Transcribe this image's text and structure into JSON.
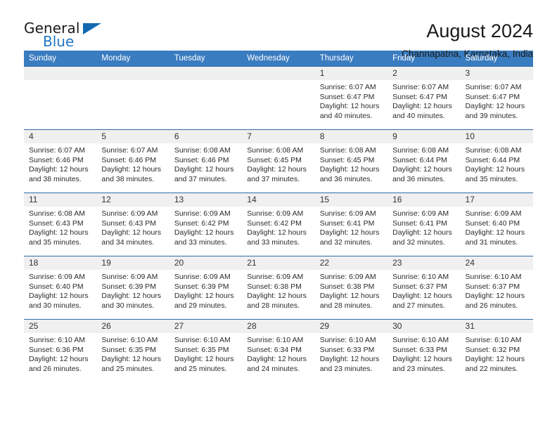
{
  "brand": {
    "name_top": "General",
    "name_bottom": "Blue",
    "triangle_color": "#1269b0",
    "blue_color": "#2176c7"
  },
  "header": {
    "title": "August 2024",
    "subtitle": "Channapatna, Karnataka, India"
  },
  "theme": {
    "header_row_bg": "#3a7cc0",
    "header_row_text": "#ffffff",
    "daynum_bg": "#f0f0f0",
    "grid_line": "#2f6ca8"
  },
  "calendar": {
    "weekday_headers": [
      "Sunday",
      "Monday",
      "Tuesday",
      "Wednesday",
      "Thursday",
      "Friday",
      "Saturday"
    ],
    "weeks": [
      [
        {
          "day": "",
          "sunrise": "",
          "sunset": "",
          "daylight": "",
          "blank": true
        },
        {
          "day": "",
          "sunrise": "",
          "sunset": "",
          "daylight": "",
          "blank": true
        },
        {
          "day": "",
          "sunrise": "",
          "sunset": "",
          "daylight": "",
          "blank": true
        },
        {
          "day": "",
          "sunrise": "",
          "sunset": "",
          "daylight": "",
          "blank": true
        },
        {
          "day": "1",
          "sunrise": "Sunrise: 6:07 AM",
          "sunset": "Sunset: 6:47 PM",
          "daylight": "Daylight: 12 hours and 40 minutes."
        },
        {
          "day": "2",
          "sunrise": "Sunrise: 6:07 AM",
          "sunset": "Sunset: 6:47 PM",
          "daylight": "Daylight: 12 hours and 40 minutes."
        },
        {
          "day": "3",
          "sunrise": "Sunrise: 6:07 AM",
          "sunset": "Sunset: 6:47 PM",
          "daylight": "Daylight: 12 hours and 39 minutes."
        }
      ],
      [
        {
          "day": "4",
          "sunrise": "Sunrise: 6:07 AM",
          "sunset": "Sunset: 6:46 PM",
          "daylight": "Daylight: 12 hours and 38 minutes."
        },
        {
          "day": "5",
          "sunrise": "Sunrise: 6:07 AM",
          "sunset": "Sunset: 6:46 PM",
          "daylight": "Daylight: 12 hours and 38 minutes."
        },
        {
          "day": "6",
          "sunrise": "Sunrise: 6:08 AM",
          "sunset": "Sunset: 6:46 PM",
          "daylight": "Daylight: 12 hours and 37 minutes."
        },
        {
          "day": "7",
          "sunrise": "Sunrise: 6:08 AM",
          "sunset": "Sunset: 6:45 PM",
          "daylight": "Daylight: 12 hours and 37 minutes."
        },
        {
          "day": "8",
          "sunrise": "Sunrise: 6:08 AM",
          "sunset": "Sunset: 6:45 PM",
          "daylight": "Daylight: 12 hours and 36 minutes."
        },
        {
          "day": "9",
          "sunrise": "Sunrise: 6:08 AM",
          "sunset": "Sunset: 6:44 PM",
          "daylight": "Daylight: 12 hours and 36 minutes."
        },
        {
          "day": "10",
          "sunrise": "Sunrise: 6:08 AM",
          "sunset": "Sunset: 6:44 PM",
          "daylight": "Daylight: 12 hours and 35 minutes."
        }
      ],
      [
        {
          "day": "11",
          "sunrise": "Sunrise: 6:08 AM",
          "sunset": "Sunset: 6:43 PM",
          "daylight": "Daylight: 12 hours and 35 minutes."
        },
        {
          "day": "12",
          "sunrise": "Sunrise: 6:09 AM",
          "sunset": "Sunset: 6:43 PM",
          "daylight": "Daylight: 12 hours and 34 minutes."
        },
        {
          "day": "13",
          "sunrise": "Sunrise: 6:09 AM",
          "sunset": "Sunset: 6:42 PM",
          "daylight": "Daylight: 12 hours and 33 minutes."
        },
        {
          "day": "14",
          "sunrise": "Sunrise: 6:09 AM",
          "sunset": "Sunset: 6:42 PM",
          "daylight": "Daylight: 12 hours and 33 minutes."
        },
        {
          "day": "15",
          "sunrise": "Sunrise: 6:09 AM",
          "sunset": "Sunset: 6:41 PM",
          "daylight": "Daylight: 12 hours and 32 minutes."
        },
        {
          "day": "16",
          "sunrise": "Sunrise: 6:09 AM",
          "sunset": "Sunset: 6:41 PM",
          "daylight": "Daylight: 12 hours and 32 minutes."
        },
        {
          "day": "17",
          "sunrise": "Sunrise: 6:09 AM",
          "sunset": "Sunset: 6:40 PM",
          "daylight": "Daylight: 12 hours and 31 minutes."
        }
      ],
      [
        {
          "day": "18",
          "sunrise": "Sunrise: 6:09 AM",
          "sunset": "Sunset: 6:40 PM",
          "daylight": "Daylight: 12 hours and 30 minutes."
        },
        {
          "day": "19",
          "sunrise": "Sunrise: 6:09 AM",
          "sunset": "Sunset: 6:39 PM",
          "daylight": "Daylight: 12 hours and 30 minutes."
        },
        {
          "day": "20",
          "sunrise": "Sunrise: 6:09 AM",
          "sunset": "Sunset: 6:39 PM",
          "daylight": "Daylight: 12 hours and 29 minutes."
        },
        {
          "day": "21",
          "sunrise": "Sunrise: 6:09 AM",
          "sunset": "Sunset: 6:38 PM",
          "daylight": "Daylight: 12 hours and 28 minutes."
        },
        {
          "day": "22",
          "sunrise": "Sunrise: 6:09 AM",
          "sunset": "Sunset: 6:38 PM",
          "daylight": "Daylight: 12 hours and 28 minutes."
        },
        {
          "day": "23",
          "sunrise": "Sunrise: 6:10 AM",
          "sunset": "Sunset: 6:37 PM",
          "daylight": "Daylight: 12 hours and 27 minutes."
        },
        {
          "day": "24",
          "sunrise": "Sunrise: 6:10 AM",
          "sunset": "Sunset: 6:37 PM",
          "daylight": "Daylight: 12 hours and 26 minutes."
        }
      ],
      [
        {
          "day": "25",
          "sunrise": "Sunrise: 6:10 AM",
          "sunset": "Sunset: 6:36 PM",
          "daylight": "Daylight: 12 hours and 26 minutes."
        },
        {
          "day": "26",
          "sunrise": "Sunrise: 6:10 AM",
          "sunset": "Sunset: 6:35 PM",
          "daylight": "Daylight: 12 hours and 25 minutes."
        },
        {
          "day": "27",
          "sunrise": "Sunrise: 6:10 AM",
          "sunset": "Sunset: 6:35 PM",
          "daylight": "Daylight: 12 hours and 25 minutes."
        },
        {
          "day": "28",
          "sunrise": "Sunrise: 6:10 AM",
          "sunset": "Sunset: 6:34 PM",
          "daylight": "Daylight: 12 hours and 24 minutes."
        },
        {
          "day": "29",
          "sunrise": "Sunrise: 6:10 AM",
          "sunset": "Sunset: 6:33 PM",
          "daylight": "Daylight: 12 hours and 23 minutes."
        },
        {
          "day": "30",
          "sunrise": "Sunrise: 6:10 AM",
          "sunset": "Sunset: 6:33 PM",
          "daylight": "Daylight: 12 hours and 23 minutes."
        },
        {
          "day": "31",
          "sunrise": "Sunrise: 6:10 AM",
          "sunset": "Sunset: 6:32 PM",
          "daylight": "Daylight: 12 hours and 22 minutes."
        }
      ]
    ]
  }
}
